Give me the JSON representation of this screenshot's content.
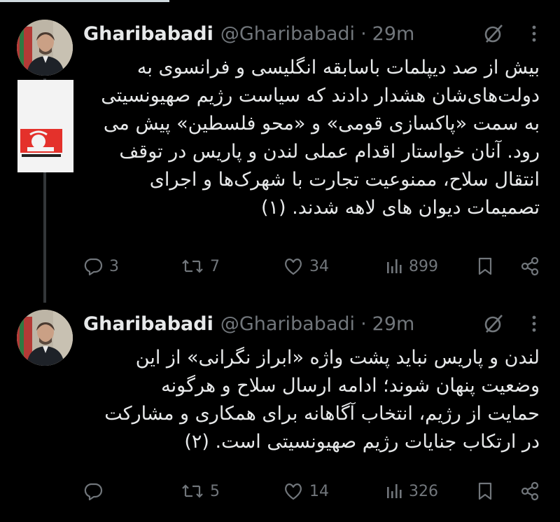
{
  "tweets": [
    {
      "author_name": "Gharibabadi",
      "handle": "@Gharibabadi",
      "separator": "·",
      "time": "29m",
      "text_lines": [
        "بیش از صد دیپلمات باسابقه انگلیسی و فرانسوی به",
        "دولت‌های‌شان هشدار دادند که سیاست رژیم صهیونسیتی",
        "به سمت «پاکسازی قومی» و «محو فلسطین» پیش می",
        "رود. آنان خواستار اقدام عملی لندن و پاریس در توقف",
        "انتقال سلاح، ممنوعیت تجارت با شهرک‌ها و اجرای",
        "تصمیمات دیوان های لاهه شدند. (۱)"
      ],
      "replies": "3",
      "reposts": "7",
      "likes": "34",
      "views": "899"
    },
    {
      "author_name": "Gharibabadi",
      "handle": "@Gharibabadi",
      "separator": "·",
      "time": "29m",
      "text_lines": [
        "لندن و پاریس نباید پشت واژه «ابراز نگرانی» از این",
        "وضعیت پنهان شوند؛ ادامه ارسال سلاح و هرگونه",
        "حمایت از رژیم، انتخاب آگاهانه برای همکاری و مشارکت",
        "در ارتکاب جنایات رژیم صهیونسیتی است. (۲)"
      ],
      "replies": "",
      "reposts": "5",
      "likes": "14",
      "views": "326"
    }
  ],
  "media_card": {
    "text": ""
  },
  "colors": {
    "background": "#000000",
    "text": "#e7e9ea",
    "muted": "#71767b",
    "line": "#333639",
    "brand_red": "#e4312b"
  },
  "icons": [
    "grok-icon",
    "more-icon",
    "reply-icon",
    "repost-icon",
    "like-icon",
    "views-icon",
    "bookmark-icon",
    "share-icon"
  ]
}
